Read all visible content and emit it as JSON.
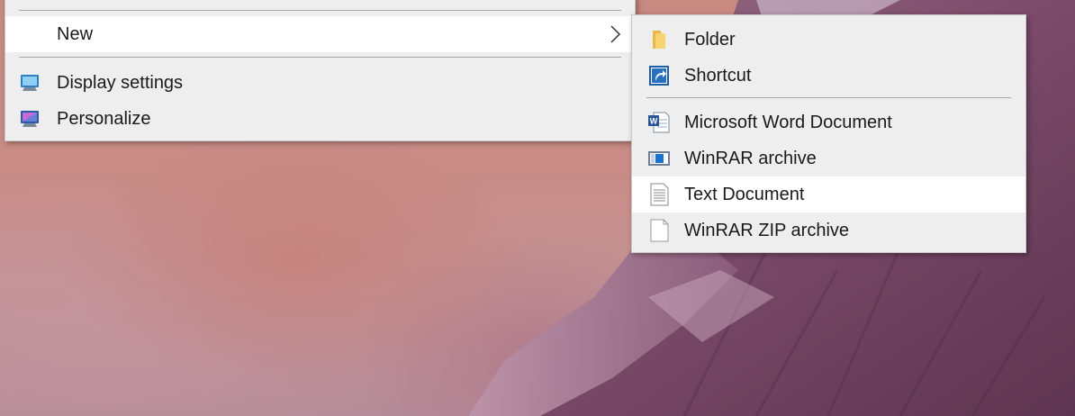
{
  "context_menu": {
    "items": [
      {
        "label": "New",
        "has_submenu": true,
        "highlighted": true
      },
      {
        "label": "Display settings",
        "icon": "display-settings-icon"
      },
      {
        "label": "Personalize",
        "icon": "personalize-icon"
      }
    ]
  },
  "new_submenu": {
    "items": [
      {
        "label": "Folder",
        "icon": "folder-icon"
      },
      {
        "label": "Shortcut",
        "icon": "shortcut-icon"
      },
      {
        "label": "Microsoft Word Document",
        "icon": "word-document-icon"
      },
      {
        "label": "WinRAR archive",
        "icon": "winrar-archive-icon"
      },
      {
        "label": "Text Document",
        "icon": "text-document-icon",
        "highlighted": true
      },
      {
        "label": "WinRAR ZIP archive",
        "icon": "winrar-zip-icon"
      }
    ]
  },
  "colors": {
    "menu_background": "#eeeeee",
    "highlight_background": "#ffffff",
    "separator": "#a8a8a8",
    "text": "#1a1a1a"
  }
}
